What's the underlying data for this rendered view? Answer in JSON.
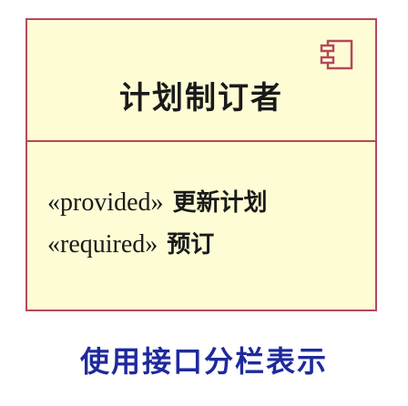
{
  "component": {
    "name": "计划制订者",
    "icon": "uml-component-icon",
    "interfaces": [
      {
        "stereotype": "«provided»",
        "name": "更新计划"
      },
      {
        "stereotype": "«required»",
        "name": "预订"
      }
    ]
  },
  "caption": "使用接口分栏表示",
  "colors": {
    "box_fill": "#fefcd4",
    "box_border": "#b5485d",
    "caption": "#1e2a9c"
  }
}
